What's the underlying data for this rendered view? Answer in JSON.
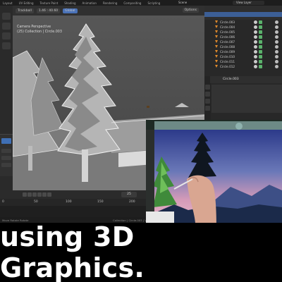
{
  "menubar": {
    "items": [
      "Layout",
      "UV Editing",
      "Texture Paint",
      "Shading",
      "Animation",
      "Rendering",
      "Compositing",
      "Scripting"
    ],
    "scene_label": "Scene",
    "view_layer_label": "View Layer"
  },
  "viewport": {
    "header_pills": [
      "Trackball",
      "1.46 : 40.60"
    ],
    "mode_pill": "Global",
    "options_label": "Options",
    "info_line1": "Camera Perspective",
    "info_line2": "(25) Collection | Circle.003"
  },
  "outliner": {
    "items": [
      "Circle.003",
      "Circle.004",
      "Circle.005",
      "Circle.006",
      "Circle.007",
      "Circle.008",
      "Circle.009",
      "Circle.010",
      "Circle.011",
      "Circle.012"
    ]
  },
  "properties": {
    "object_name": "Circle.003"
  },
  "timeline": {
    "ruler_ticks": [
      "0",
      "50",
      "100",
      "150",
      "200"
    ],
    "current_frame": "25"
  },
  "statusbar": {
    "left": "Move   Rotate   Rotate",
    "right": "Collection | Circle.003 | V..."
  },
  "caption": {
    "text": "using 3D Graphics."
  },
  "colors": {
    "accent_blue": "#4a72b8",
    "outliner_triangle": "#e08a2c",
    "outliner_green": "#5bb36c",
    "caption_bg": "#000000",
    "caption_text": "#ffffff"
  },
  "icons": [
    "camera-icon",
    "move-tool-icon",
    "rotate-tool-icon",
    "scale-tool-icon",
    "play-icon",
    "pause-icon",
    "eye-icon",
    "filter-icon",
    "cone-icon"
  ]
}
